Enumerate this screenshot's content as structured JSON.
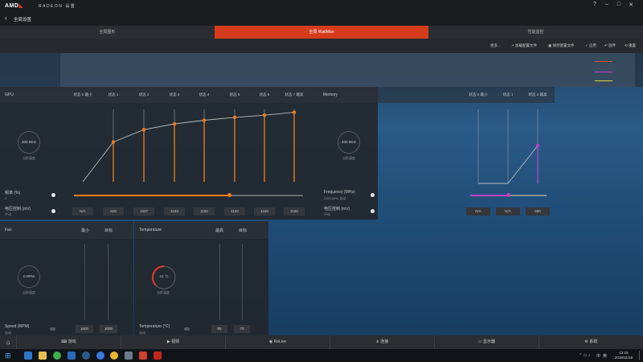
{
  "app": {
    "logo_text": "AMD",
    "title": "RADEON 设置",
    "page_title": "全局设置",
    "window_controls": [
      "?",
      "–",
      "□",
      "✕"
    ]
  },
  "tabs": [
    {
      "label": "全局图形",
      "active": false
    },
    {
      "label": "全局 WattMan",
      "active": true
    },
    {
      "label": "性能监控",
      "active": false
    }
  ],
  "toolbar": {
    "more": "更多...",
    "load_profile": "加载配置文件",
    "save_profile": "保存配置文件",
    "apply": "应用",
    "discard": "放弃",
    "reset": "重置"
  },
  "gpu": {
    "title": "GPU",
    "states": [
      "状态 0 最小",
      "状态 1",
      "状态 2",
      "状态 3",
      "状态 4",
      "状态 5",
      "状态 6",
      "状态 7 最高"
    ],
    "gauge_value": "300 MHz",
    "gauge_label": "当前速度",
    "frequency_label": "频率 (%)",
    "frequency_value": "0",
    "voltage_label": "电压控制 (mV)",
    "voltage_mode": "手动",
    "voltages": [
      "N/A",
      "825",
      "1027",
      "1193",
      "1150",
      "1150",
      "1150",
      "1150"
    ],
    "curve_levels": [
      0.0,
      0.55,
      0.72,
      0.8,
      0.85,
      0.89,
      0.92,
      0.96
    ],
    "slider_level": 0.68
  },
  "memory": {
    "title": "Memory",
    "states": [
      "状态 0 最小",
      "状态 1",
      "状态 2 最高"
    ],
    "gauge_value": "400 MHz",
    "gauge_label": "当前速度",
    "frequency_label": "Frequency (MHz)",
    "frequency_value": "2000 MHz 自动",
    "voltage_label": "电压控制 (mV)",
    "voltage_mode": "手动",
    "voltages": [
      "N/A",
      "N/A",
      "950"
    ],
    "slider_level": 0.5
  },
  "fan": {
    "title": "Fan",
    "col_min": "最小",
    "col_target": "目标",
    "gauge_value": "0 RPM",
    "gauge_label": "当前速度",
    "speed_label": "Speed (RPM)",
    "speed_mode": "自动",
    "values": [
      "1600",
      "3000"
    ]
  },
  "temperature": {
    "title": "Temperature",
    "col_max": "最高",
    "col_target": "目标",
    "gauge_value": "41 °C",
    "gauge_label": "当前温度",
    "label": "Temperature (°C)",
    "mode": "自动",
    "values": [
      "85",
      "70"
    ]
  },
  "bottom_nav": [
    {
      "label": "游戏",
      "icon": "gamepad-icon"
    },
    {
      "label": "视频",
      "icon": "play-icon"
    },
    {
      "label": "ReLive",
      "icon": "relive-icon"
    },
    {
      "label": "连接",
      "icon": "share-icon"
    },
    {
      "label": "显示器",
      "icon": "monitor-icon"
    },
    {
      "label": "系统",
      "icon": "gear-icon"
    }
  ],
  "taskbar": {
    "time": "12:15",
    "date": "2018/11/15",
    "ime": "中",
    "lang": "英"
  },
  "colors": {
    "accent": "#d63c1c",
    "gpu_curve": "#f07c1c",
    "memory_curve": "#c040c0"
  }
}
